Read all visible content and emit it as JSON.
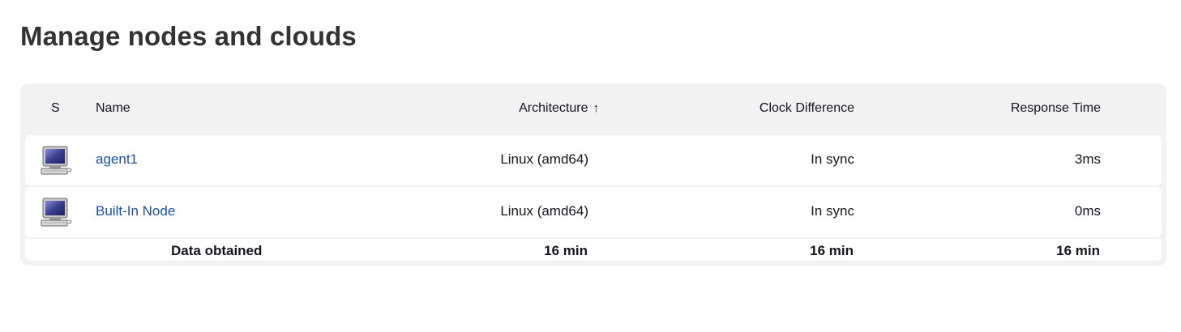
{
  "page": {
    "title": "Manage nodes and clouds"
  },
  "table": {
    "headers": {
      "status": "S",
      "name": "Name",
      "architecture": "Architecture",
      "sort_indicator": "↑",
      "clock_difference": "Clock Difference",
      "response_time": "Response Time"
    },
    "rows": [
      {
        "icon": "computer-icon",
        "name": "agent1",
        "architecture": "Linux (amd64)",
        "clock_difference": "In sync",
        "response_time": "3ms"
      },
      {
        "icon": "computer-icon",
        "name": "Built-In Node",
        "architecture": "Linux (amd64)",
        "clock_difference": "In sync",
        "response_time": "0ms"
      }
    ],
    "footer": {
      "label": "Data obtained",
      "architecture": "16 min",
      "clock_difference": "16 min",
      "response_time": "16 min"
    }
  },
  "colors": {
    "link": "#1a4fa8",
    "table_bg": "#f2f2f2",
    "title": "#333333"
  }
}
